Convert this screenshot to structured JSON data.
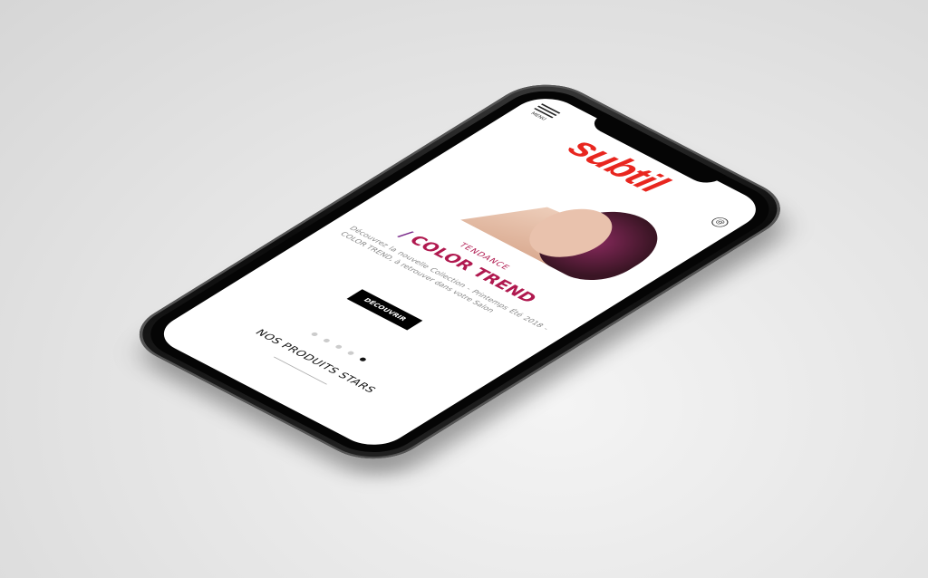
{
  "header": {
    "menu_label": "MENU",
    "logo": "subtil",
    "user_icon": "at-icon"
  },
  "hero": {
    "kicker": "TENDANCE",
    "slash": "/",
    "title": "COLOR TREND",
    "description": "Découvrez la nouvelle Collection - Printemps Été 2018 - COLOR TREND, à retrouver dans votre Salon",
    "button": "DÉCOUVRIR",
    "slides_total": 5,
    "active_slide": 5
  },
  "section": {
    "title": "NOS PRODUITS STARS"
  },
  "colors": {
    "brand": "#e8261f",
    "accent": "#b0194f"
  }
}
